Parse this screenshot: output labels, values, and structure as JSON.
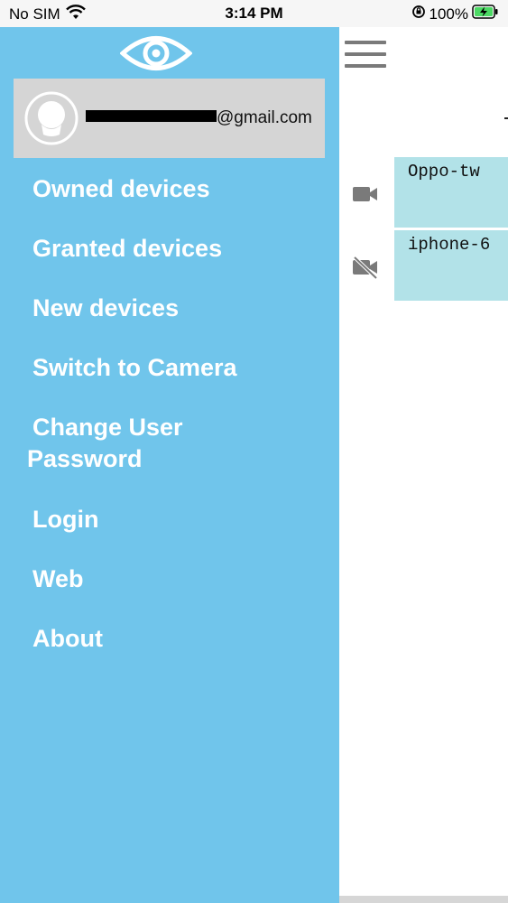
{
  "status_bar": {
    "carrier": "No SIM",
    "time": "3:14 PM",
    "battery": "100%"
  },
  "drawer": {
    "user_email_visible": "@gmail.com",
    "menu": [
      {
        "label": "Owned devices"
      },
      {
        "label": "Granted devices"
      },
      {
        "label": "New devices"
      },
      {
        "label": "Switch to Camera"
      },
      {
        "label_line1": "Change User",
        "label_line2": "Password"
      },
      {
        "label": "Login"
      },
      {
        "label": "Web"
      },
      {
        "label": "About"
      }
    ]
  },
  "main": {
    "devices": [
      {
        "name": "Oppo-tw",
        "icon": "videocam-icon"
      },
      {
        "name": "iphone-6",
        "icon": "videocam-off-icon"
      }
    ]
  },
  "colors": {
    "drawer_bg": "#70c5eb",
    "user_box_bg": "#d5d5d5",
    "device_card_bg": "#b2e2e8",
    "menu_text": "#ffffff",
    "icon_gray": "#7a7a7a"
  }
}
